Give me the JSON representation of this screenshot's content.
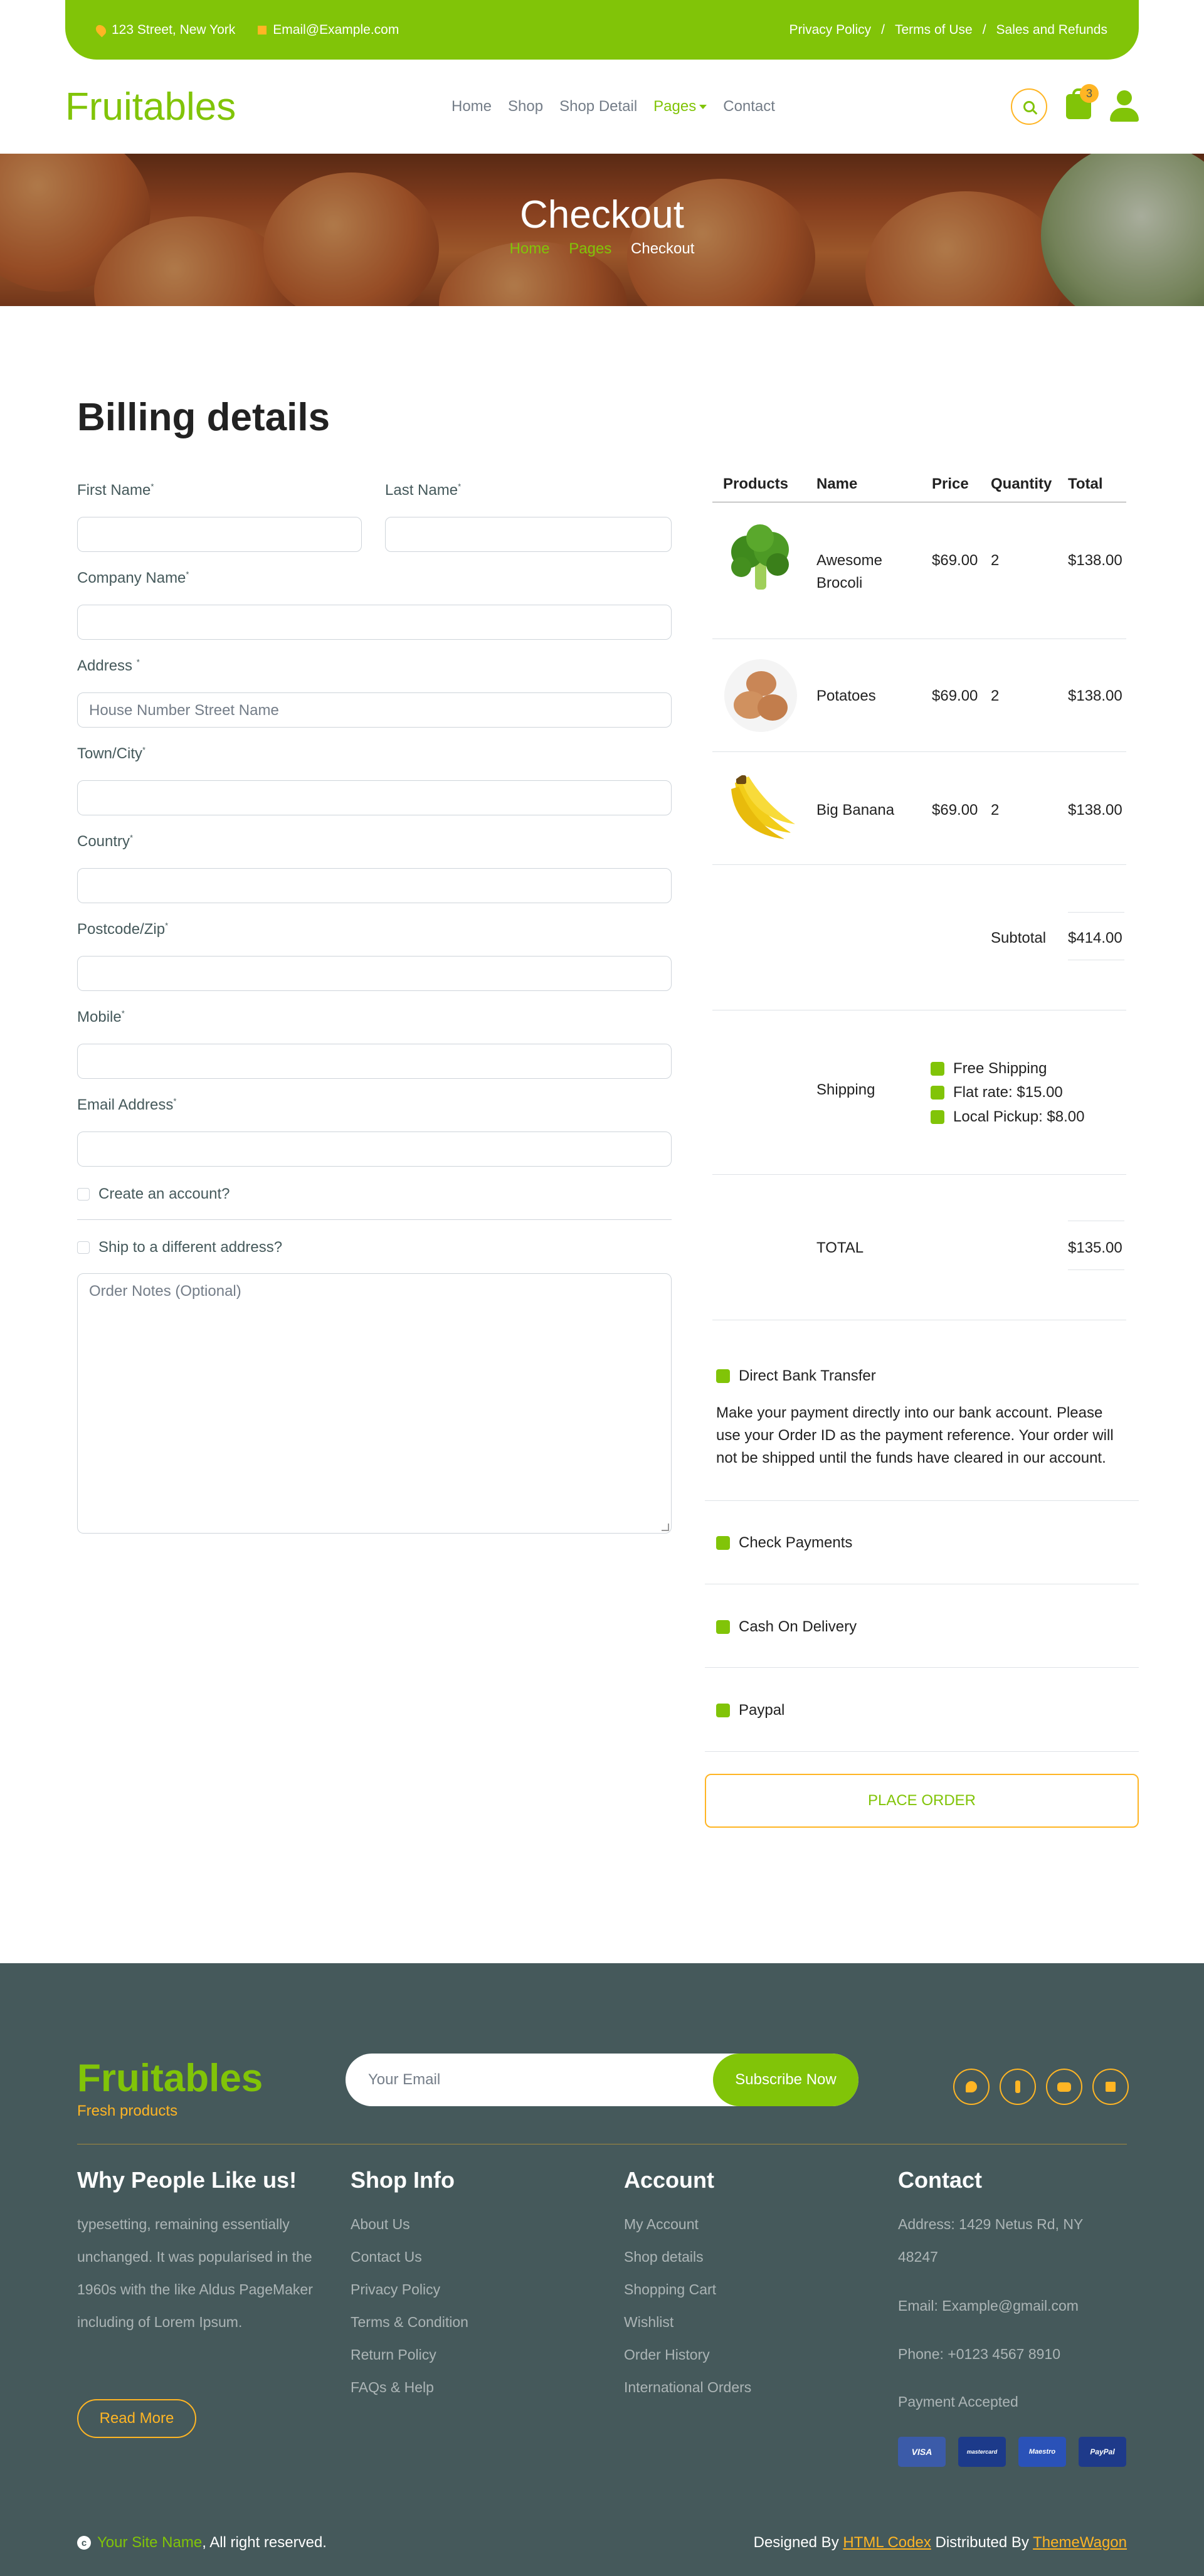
{
  "topbar": {
    "address": "123 Street, New York",
    "email": "Email@Example.com",
    "links": [
      "Privacy Policy",
      "Terms of Use",
      "Sales and Refunds"
    ],
    "sep": "/"
  },
  "brand": {
    "name": "Fruitables",
    "tagline": "Fresh products"
  },
  "nav": {
    "items": [
      "Home",
      "Shop",
      "Shop Detail",
      "Pages",
      "Contact"
    ],
    "active": "Pages",
    "cart_count": "3"
  },
  "hero": {
    "title": "Checkout",
    "breadcrumb": [
      "Home",
      "Pages",
      "Checkout"
    ]
  },
  "billing": {
    "title": "Billing details",
    "fields": {
      "first_name": "First Name",
      "last_name": "Last Name",
      "company": "Company Name",
      "address": "Address",
      "address_placeholder": "House Number Street Name",
      "town": "Town/City",
      "country": "Country",
      "postcode": "Postcode/Zip",
      "mobile": "Mobile",
      "email": "Email Address",
      "required_mark": "*"
    },
    "create_account": "Create an account?",
    "ship_different": "Ship to a different address?",
    "notes_placeholder": "Order Notes (Optional)"
  },
  "order": {
    "headers": [
      "Products",
      "Name",
      "Price",
      "Quantity",
      "Total"
    ],
    "rows": [
      {
        "image": "broccoli-image",
        "name": "Awesome Brocoli",
        "price": "$69.00",
        "qty": "2",
        "total": "$138.00"
      },
      {
        "image": "potatoes-image",
        "name": "Potatoes",
        "price": "$69.00",
        "qty": "2",
        "total": "$138.00"
      },
      {
        "image": "banana-image",
        "name": "Big Banana",
        "price": "$69.00",
        "qty": "2",
        "total": "$138.00"
      }
    ],
    "subtotal_label": "Subtotal",
    "subtotal": "$414.00",
    "shipping_label": "Shipping",
    "shipping_options": [
      "Free Shipping",
      "Flat rate: $15.00",
      "Local Pickup: $8.00"
    ],
    "total_label": "TOTAL",
    "total": "$135.00"
  },
  "payment": {
    "methods": [
      "Direct Bank Transfer",
      "Check Payments",
      "Cash On Delivery",
      "Paypal"
    ],
    "bank_desc": "Make your payment directly into our bank account. Please use your Order ID as the payment reference. Your order will not be shipped until the funds have cleared in our account.",
    "place_order": "PLACE ORDER"
  },
  "footer": {
    "email_placeholder": "Your Email",
    "subscribe": "Subscribe Now",
    "social": [
      "twitter-icon",
      "facebook-icon",
      "youtube-icon",
      "linkedin-icon"
    ],
    "why_title": "Why People Like us!",
    "why_text": "typesetting, remaining essentially unchanged. It was popularised in the 1960s with the like Aldus PageMaker including of Lorem Ipsum.",
    "read_more": "Read More",
    "shop_title": "Shop Info",
    "shop_links": [
      "About Us",
      "Contact Us",
      "Privacy Policy",
      "Terms & Condition",
      "Return Policy",
      "FAQs & Help"
    ],
    "account_title": "Account",
    "account_links": [
      "My Account",
      "Shop details",
      "Shopping Cart",
      "Wishlist",
      "Order History",
      "International Orders"
    ],
    "contact_title": "Contact",
    "contact_address": "Address: 1429 Netus Rd, NY 48247",
    "contact_email": "Email: Example@gmail.com",
    "contact_phone": "Phone: +0123 4567 8910",
    "payment_accepted": "Payment Accepted",
    "cards": [
      "VISA",
      "mastercard",
      "Maestro",
      "PayPal"
    ],
    "copy_site": "Your Site Name",
    "copy_rest": ", All right reserved.",
    "designed_by": "Designed By",
    "designer": "HTML Codex",
    "distributed_by": "Distributed By",
    "distributor": "ThemeWagon"
  }
}
